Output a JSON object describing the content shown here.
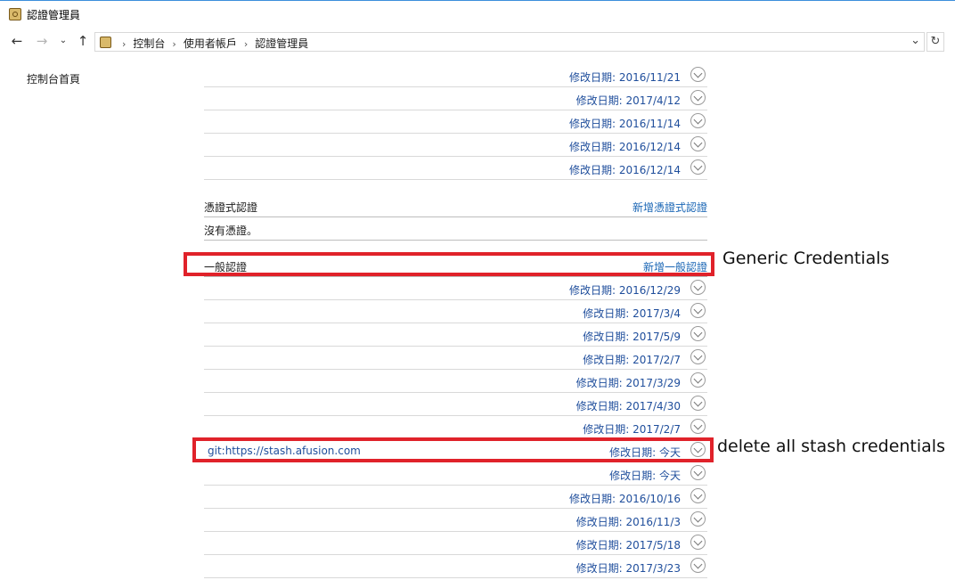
{
  "window": {
    "title": "認證管理員"
  },
  "address": {
    "crumbs": [
      "控制台",
      "使用者帳戶",
      "認證管理員"
    ]
  },
  "leftnav": {
    "home": "控制台首頁"
  },
  "top_rows": [
    {
      "date": "修改日期: 2016/11/21"
    },
    {
      "date": "修改日期: 2017/4/12"
    },
    {
      "date": "修改日期: 2016/11/14"
    },
    {
      "date": "修改日期: 2016/12/14"
    },
    {
      "date": "修改日期: 2016/12/14"
    }
  ],
  "cert_section": {
    "title": "憑證式認證",
    "add_link": "新增憑證式認證",
    "empty_text": "沒有憑證。"
  },
  "generic_section": {
    "title": "一般認證",
    "add_link": "新增一般認證"
  },
  "generic_rows": [
    {
      "name": "",
      "date": "修改日期: 2016/12/29"
    },
    {
      "name": "",
      "date": "修改日期: 2017/3/4"
    },
    {
      "name": "",
      "date": "修改日期: 2017/5/9"
    },
    {
      "name": "",
      "date": "修改日期: 2017/2/7"
    },
    {
      "name": "",
      "date": "修改日期: 2017/3/29"
    },
    {
      "name": "",
      "date": "修改日期: 2017/4/30"
    },
    {
      "name": "",
      "date": "修改日期: 2017/2/7"
    },
    {
      "name": "git:https://stash.afusion.com",
      "date": "修改日期: 今天"
    },
    {
      "name": "",
      "date": "修改日期: 今天"
    },
    {
      "name": "",
      "date": "修改日期: 2016/10/16"
    },
    {
      "name": "",
      "date": "修改日期: 2016/11/3"
    },
    {
      "name": "",
      "date": "修改日期: 2017/5/18"
    },
    {
      "name": "",
      "date": "修改日期: 2017/3/23"
    }
  ],
  "annotations": {
    "generic": "Generic Credentials",
    "stash": "delete all stash credentials",
    "highlight_color": "#e0222a"
  }
}
